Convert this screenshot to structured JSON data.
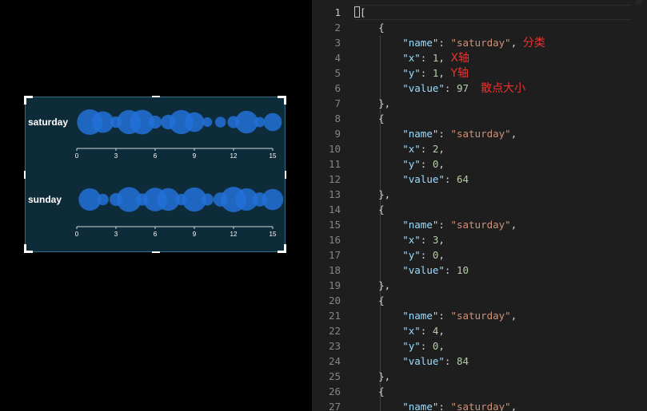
{
  "chart_data": {
    "type": "scatter",
    "rows": [
      {
        "name": "saturday",
        "sizes": [
          97,
          64,
          10,
          84,
          88,
          15,
          22,
          85,
          50,
          5,
          8,
          12,
          72,
          7,
          40
        ]
      },
      {
        "name": "sunday",
        "sizes": [
          70,
          10,
          15,
          90,
          12,
          80,
          72,
          10,
          85,
          12,
          20,
          95,
          70,
          20,
          60
        ]
      }
    ],
    "x_ticks": [
      "0",
      "3",
      "6",
      "9",
      "12",
      "15"
    ],
    "xlim": [
      0,
      15
    ],
    "bubble_color": "#2271d8"
  },
  "editor": {
    "lines": [
      {
        "n": "1",
        "parts": [
          [
            "cursor",
            ""
          ],
          [
            "p",
            "["
          ]
        ]
      },
      {
        "n": "2",
        "parts": [
          [
            "p",
            "    {"
          ]
        ]
      },
      {
        "n": "3",
        "parts": [
          [
            "p",
            "        "
          ],
          [
            "k",
            "\"name\""
          ],
          [
            "p",
            ": "
          ],
          [
            "s",
            "\"saturday\""
          ],
          [
            "p",
            ", "
          ],
          [
            "note",
            "分类"
          ]
        ]
      },
      {
        "n": "4",
        "parts": [
          [
            "p",
            "        "
          ],
          [
            "k",
            "\"x\""
          ],
          [
            "p",
            ": "
          ],
          [
            "n",
            "1"
          ],
          [
            "p",
            ", "
          ],
          [
            "note",
            "X轴"
          ]
        ]
      },
      {
        "n": "5",
        "parts": [
          [
            "p",
            "        "
          ],
          [
            "k",
            "\"y\""
          ],
          [
            "p",
            ": "
          ],
          [
            "n",
            "1"
          ],
          [
            "p",
            ", "
          ],
          [
            "note",
            "Y轴"
          ]
        ]
      },
      {
        "n": "6",
        "parts": [
          [
            "p",
            "        "
          ],
          [
            "k",
            "\"value\""
          ],
          [
            "p",
            ": "
          ],
          [
            "n",
            "97"
          ],
          [
            "p",
            "  "
          ],
          [
            "note",
            "散点大小"
          ]
        ]
      },
      {
        "n": "7",
        "parts": [
          [
            "p",
            "    },"
          ]
        ]
      },
      {
        "n": "8",
        "parts": [
          [
            "p",
            "    {"
          ]
        ]
      },
      {
        "n": "9",
        "parts": [
          [
            "p",
            "        "
          ],
          [
            "k",
            "\"name\""
          ],
          [
            "p",
            ": "
          ],
          [
            "s",
            "\"saturday\""
          ],
          [
            "p",
            ","
          ]
        ]
      },
      {
        "n": "10",
        "parts": [
          [
            "p",
            "        "
          ],
          [
            "k",
            "\"x\""
          ],
          [
            "p",
            ": "
          ],
          [
            "n",
            "2"
          ],
          [
            "p",
            ","
          ]
        ]
      },
      {
        "n": "11",
        "parts": [
          [
            "p",
            "        "
          ],
          [
            "k",
            "\"y\""
          ],
          [
            "p",
            ": "
          ],
          [
            "n",
            "0"
          ],
          [
            "p",
            ","
          ]
        ]
      },
      {
        "n": "12",
        "parts": [
          [
            "p",
            "        "
          ],
          [
            "k",
            "\"value\""
          ],
          [
            "p",
            ": "
          ],
          [
            "n",
            "64"
          ]
        ]
      },
      {
        "n": "13",
        "parts": [
          [
            "p",
            "    },"
          ]
        ]
      },
      {
        "n": "14",
        "parts": [
          [
            "p",
            "    {"
          ]
        ]
      },
      {
        "n": "15",
        "parts": [
          [
            "p",
            "        "
          ],
          [
            "k",
            "\"name\""
          ],
          [
            "p",
            ": "
          ],
          [
            "s",
            "\"saturday\""
          ],
          [
            "p",
            ","
          ]
        ]
      },
      {
        "n": "16",
        "parts": [
          [
            "p",
            "        "
          ],
          [
            "k",
            "\"x\""
          ],
          [
            "p",
            ": "
          ],
          [
            "n",
            "3"
          ],
          [
            "p",
            ","
          ]
        ]
      },
      {
        "n": "17",
        "parts": [
          [
            "p",
            "        "
          ],
          [
            "k",
            "\"y\""
          ],
          [
            "p",
            ": "
          ],
          [
            "n",
            "0"
          ],
          [
            "p",
            ","
          ]
        ]
      },
      {
        "n": "18",
        "parts": [
          [
            "p",
            "        "
          ],
          [
            "k",
            "\"value\""
          ],
          [
            "p",
            ": "
          ],
          [
            "n",
            "10"
          ]
        ]
      },
      {
        "n": "19",
        "parts": [
          [
            "p",
            "    },"
          ]
        ]
      },
      {
        "n": "20",
        "parts": [
          [
            "p",
            "    {"
          ]
        ]
      },
      {
        "n": "21",
        "parts": [
          [
            "p",
            "        "
          ],
          [
            "k",
            "\"name\""
          ],
          [
            "p",
            ": "
          ],
          [
            "s",
            "\"saturday\""
          ],
          [
            "p",
            ","
          ]
        ]
      },
      {
        "n": "22",
        "parts": [
          [
            "p",
            "        "
          ],
          [
            "k",
            "\"x\""
          ],
          [
            "p",
            ": "
          ],
          [
            "n",
            "4"
          ],
          [
            "p",
            ","
          ]
        ]
      },
      {
        "n": "23",
        "parts": [
          [
            "p",
            "        "
          ],
          [
            "k",
            "\"y\""
          ],
          [
            "p",
            ": "
          ],
          [
            "n",
            "0"
          ],
          [
            "p",
            ","
          ]
        ]
      },
      {
        "n": "24",
        "parts": [
          [
            "p",
            "        "
          ],
          [
            "k",
            "\"value\""
          ],
          [
            "p",
            ": "
          ],
          [
            "n",
            "84"
          ]
        ]
      },
      {
        "n": "25",
        "parts": [
          [
            "p",
            "    },"
          ]
        ]
      },
      {
        "n": "26",
        "parts": [
          [
            "p",
            "    {"
          ]
        ]
      },
      {
        "n": "27",
        "parts": [
          [
            "p",
            "        "
          ],
          [
            "k",
            "\"name\""
          ],
          [
            "p",
            ": "
          ],
          [
            "s",
            "\"saturday\""
          ],
          [
            "p",
            ","
          ]
        ]
      }
    ]
  }
}
